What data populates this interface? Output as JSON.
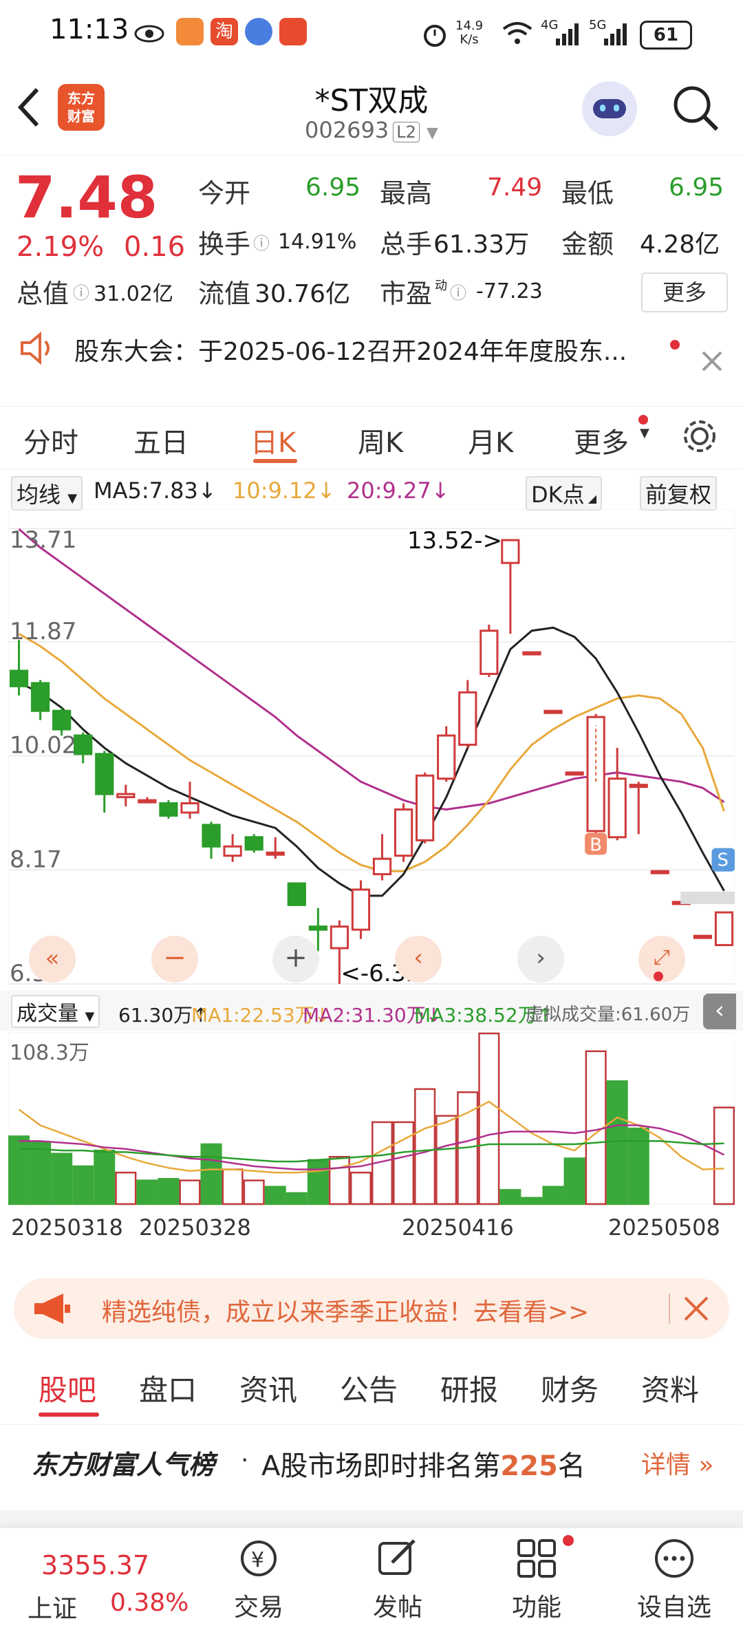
{
  "status": {
    "time": "11:13",
    "net_speed_top": "14.9",
    "net_speed_bottom": "K/s",
    "net1": "4G",
    "net2": "5G",
    "battery": "61"
  },
  "header": {
    "title": "*ST双成",
    "code": "002693",
    "level_badge": "L2",
    "logo_text_1": "东方",
    "logo_text_2": "财富"
  },
  "quote": {
    "price": "7.48",
    "change_pct": "2.19%",
    "change": "0.16",
    "open_label": "今开",
    "open": "6.95",
    "high_label": "最高",
    "high": "7.49",
    "low_label": "最低",
    "low": "6.95",
    "turnover_label": "换手",
    "turnover": "14.91%",
    "volume_label": "总手",
    "volume": "61.33万",
    "amount_label": "金额",
    "amount": "4.28亿",
    "mktcap_label": "总值",
    "mktcap": "31.02亿",
    "float_label": "流值",
    "float": "30.76亿",
    "pe_label": "市盈",
    "pe_sup": "动",
    "pe": "-77.23",
    "more_label": "更多"
  },
  "notice": {
    "text": "股东大会：于2025-06-12召开2024年年度股东..."
  },
  "ktabs": [
    "分时",
    "五日",
    "日K",
    "周K",
    "月K",
    "更多"
  ],
  "ktabs_active": 2,
  "ma_row": {
    "selector": "均线",
    "ma5": "MA5:7.83",
    "ma10": "10:9.12",
    "ma20": "20:9.27",
    "dk": "DK点",
    "adjust": "前复权",
    "ma5_color": "#222222",
    "ma10_color": "#e8a83a",
    "ma20_color": "#b0308c"
  },
  "chart_data": [
    {
      "type": "candlestick",
      "y_axis_labels": [
        "13.71",
        "11.87",
        "10.02",
        "8.17",
        "6.32"
      ],
      "ylim": [
        6.32,
        13.71
      ],
      "high_annotation": "13.52->",
      "low_annotation": "<-6.32",
      "up_color": "#d03a3a",
      "down_color": "#2a9d2a",
      "candles": [
        {
          "o": 11.4,
          "c": 11.15,
          "h": 11.9,
          "l": 11.0
        },
        {
          "o": 11.2,
          "c": 10.75,
          "h": 11.25,
          "l": 10.6
        },
        {
          "o": 10.75,
          "c": 10.45,
          "h": 10.8,
          "l": 10.35
        },
        {
          "o": 10.35,
          "c": 10.05,
          "h": 10.4,
          "l": 9.9
        },
        {
          "o": 10.05,
          "c": 9.4,
          "h": 10.1,
          "l": 9.1
        },
        {
          "o": 9.35,
          "c": 9.4,
          "h": 9.55,
          "l": 9.2
        },
        {
          "o": 9.3,
          "c": 9.3,
          "h": 9.35,
          "l": 9.25
        },
        {
          "o": 9.25,
          "c": 9.05,
          "h": 9.3,
          "l": 9.0
        },
        {
          "o": 9.1,
          "c": 9.25,
          "h": 9.6,
          "l": 9.0
        },
        {
          "o": 8.9,
          "c": 8.55,
          "h": 8.95,
          "l": 8.35
        },
        {
          "o": 8.4,
          "c": 8.55,
          "h": 8.75,
          "l": 8.3
        },
        {
          "o": 8.7,
          "c": 8.5,
          "h": 8.75,
          "l": 8.45
        },
        {
          "o": 8.45,
          "c": 8.45,
          "h": 8.7,
          "l": 8.35
        },
        {
          "o": 7.95,
          "c": 7.6,
          "h": 7.95,
          "l": 7.6
        },
        {
          "o": 7.25,
          "c": 7.2,
          "h": 7.55,
          "l": 6.85
        },
        {
          "o": 6.9,
          "c": 7.25,
          "h": 7.35,
          "l": 6.32
        },
        {
          "o": 7.2,
          "c": 7.85,
          "h": 8.0,
          "l": 7.05
        },
        {
          "o": 8.1,
          "c": 8.35,
          "h": 8.75,
          "l": 8.0
        },
        {
          "o": 8.4,
          "c": 9.15,
          "h": 9.25,
          "l": 8.3
        },
        {
          "o": 8.65,
          "c": 9.7,
          "h": 9.75,
          "l": 8.6
        },
        {
          "o": 9.65,
          "c": 10.35,
          "h": 10.5,
          "l": 9.6
        },
        {
          "o": 10.2,
          "c": 11.05,
          "h": 11.25,
          "l": 10.15
        },
        {
          "o": 11.35,
          "c": 12.05,
          "h": 12.15,
          "l": 11.3
        },
        {
          "o": 13.15,
          "c": 13.52,
          "h": 13.52,
          "l": 12.0
        },
        {
          "o": 11.7,
          "c": 11.7,
          "h": 11.7,
          "l": 11.7
        },
        {
          "o": 10.75,
          "c": 10.75,
          "h": 10.75,
          "l": 10.75
        },
        {
          "o": 9.75,
          "c": 9.75,
          "h": 9.75,
          "l": 9.75
        },
        {
          "o": 8.8,
          "c": 10.65,
          "h": 10.7,
          "l": 8.75
        },
        {
          "o": 8.7,
          "c": 9.65,
          "h": 10.15,
          "l": 8.65
        },
        {
          "o": 9.55,
          "c": 9.55,
          "h": 9.6,
          "l": 8.75
        },
        {
          "o": 8.15,
          "c": 8.15,
          "h": 8.15,
          "l": 8.15
        },
        {
          "o": 7.65,
          "c": 7.65,
          "h": 7.65,
          "l": 7.65
        },
        {
          "o": 7.1,
          "c": 7.1,
          "h": 7.1,
          "l": 7.1
        },
        {
          "o": 6.95,
          "c": 7.48,
          "h": 7.49,
          "l": 6.95
        }
      ],
      "ma5": [
        11.2,
        11.05,
        10.8,
        10.45,
        10.15,
        9.9,
        9.7,
        9.5,
        9.35,
        9.2,
        9.05,
        8.95,
        8.85,
        8.55,
        8.2,
        7.95,
        7.75,
        7.75,
        8.1,
        8.7,
        9.35,
        10.15,
        10.95,
        11.75,
        12.05,
        12.1,
        11.95,
        11.6,
        11.05,
        10.4,
        9.7,
        9.1,
        8.45,
        7.83
      ],
      "ma10": [
        12.0,
        11.8,
        11.55,
        11.25,
        10.95,
        10.7,
        10.45,
        10.2,
        9.95,
        9.75,
        9.55,
        9.35,
        9.15,
        8.95,
        8.7,
        8.45,
        8.25,
        8.15,
        8.15,
        8.3,
        8.55,
        8.9,
        9.3,
        9.8,
        10.2,
        10.45,
        10.65,
        10.8,
        10.95,
        11.0,
        10.95,
        10.7,
        10.15,
        9.12
      ],
      "ma20": [
        13.7,
        13.4,
        13.15,
        12.9,
        12.65,
        12.4,
        12.15,
        11.9,
        11.65,
        11.4,
        11.15,
        10.9,
        10.65,
        10.35,
        10.1,
        9.85,
        9.6,
        9.45,
        9.3,
        9.2,
        9.15,
        9.2,
        9.25,
        9.35,
        9.45,
        9.55,
        9.65,
        9.7,
        9.75,
        9.7,
        9.65,
        9.6,
        9.5,
        9.27
      ]
    },
    {
      "type": "bar",
      "title": "成交量",
      "y_top_label": "108.3万",
      "ymax": 108.3,
      "volumes": [
        43,
        39,
        32,
        24,
        34,
        20,
        15,
        16,
        15,
        38,
        22,
        15,
        11,
        7,
        28,
        30,
        20,
        52,
        52,
        73,
        56,
        71,
        108.3,
        9,
        4,
        11,
        29,
        97,
        78,
        48,
        0,
        0,
        0,
        61.3
      ],
      "up": [
        false,
        false,
        false,
        false,
        false,
        true,
        false,
        false,
        true,
        false,
        true,
        true,
        false,
        false,
        false,
        true,
        true,
        true,
        true,
        true,
        true,
        true,
        true,
        false,
        false,
        false,
        false,
        true,
        false,
        false,
        false,
        false,
        false,
        true
      ],
      "ma1": [
        60,
        50,
        45,
        40,
        35,
        30,
        26,
        23,
        21,
        22,
        22,
        21,
        20,
        20,
        21,
        23,
        27,
        34,
        41,
        48,
        52,
        58,
        65,
        55,
        45,
        38,
        34,
        45,
        55,
        50,
        42,
        30,
        22,
        22.53
      ],
      "ma2": [
        40,
        40,
        39,
        38,
        36,
        35,
        33,
        31,
        29,
        28,
        26,
        24,
        23,
        22,
        22,
        23,
        24,
        27,
        30,
        33,
        37,
        40,
        44,
        46,
        46,
        46,
        45,
        47,
        50,
        50,
        48,
        44,
        38,
        31.3
      ],
      "ma3": [
        35,
        35,
        34,
        34,
        33,
        33,
        32,
        31,
        30,
        30,
        29,
        28,
        27,
        27,
        28,
        29,
        30,
        31,
        33,
        34,
        35,
        36,
        38,
        38,
        38,
        38,
        38,
        39,
        40,
        40,
        40,
        39,
        38,
        38.52
      ],
      "dates": [
        "20250318",
        "20250328",
        "20250416",
        "20250508"
      ]
    }
  ],
  "vol_row": {
    "selector": "成交量",
    "vol": "61.30万",
    "ma1": "MA1:22.53万",
    "ma2": "MA2:31.30万",
    "ma3": "MA3:38.52万",
    "virtual": "虚拟成交量:61.60万"
  },
  "ad": {
    "text": "精选纯债，成立以来季季正收益！去看看>>"
  },
  "btabs": [
    "股吧",
    "盘口",
    "资讯",
    "公告",
    "研报",
    "财务",
    "资料"
  ],
  "btabs_active": 0,
  "rank": {
    "brand": "东方财富人气榜",
    "pre": "A股市场即时排名第",
    "num": "225",
    "post": "名",
    "detail": "详情"
  },
  "footer": {
    "index_value": "3355.37",
    "index_name": "上证",
    "index_change": "0.38%",
    "items": [
      "交易",
      "发帖",
      "功能",
      "设自选"
    ]
  },
  "chart_controls": {
    "b_marker": "B",
    "s_marker": "S"
  }
}
